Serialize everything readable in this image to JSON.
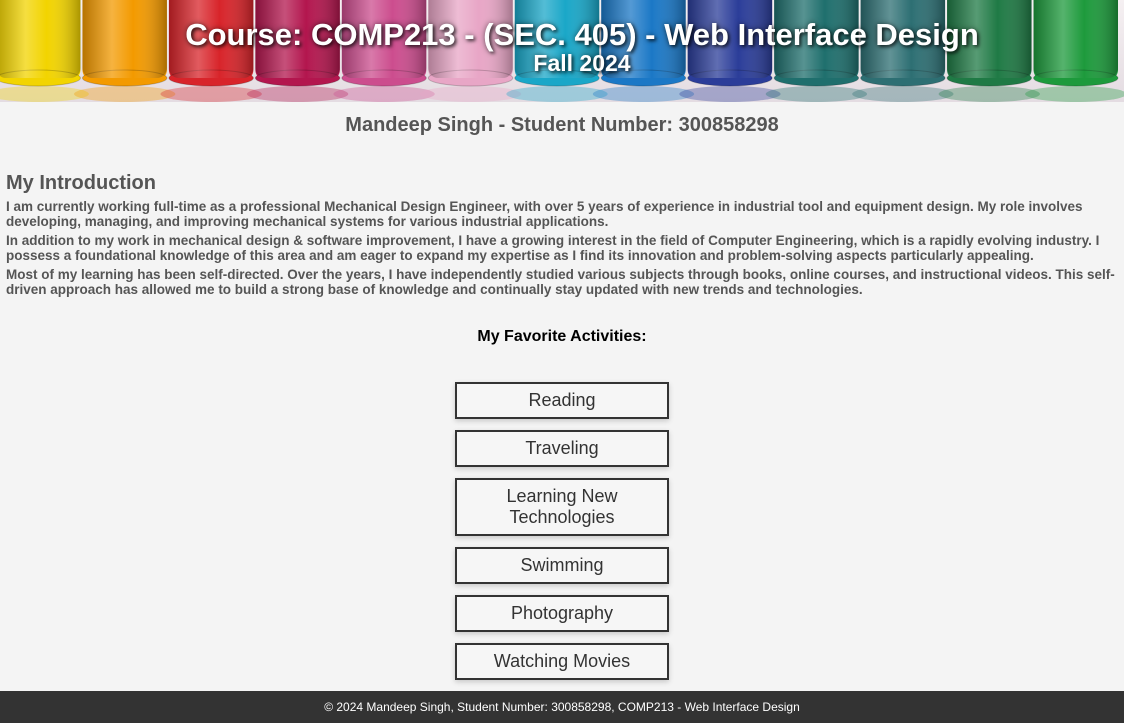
{
  "header": {
    "title": "Course: COMP213 - (SEC. 405) - Web Interface Design",
    "subtitle": "Fall 2024",
    "crayon_colors": [
      "#f2d400",
      "#f39a00",
      "#d8242a",
      "#b3164e",
      "#cc4d8e",
      "#e8a6c6",
      "#1aa7c8",
      "#1b78c6",
      "#2b3d99",
      "#1f6f6d",
      "#2d6f73",
      "#1f7a45",
      "#1d9a3c"
    ]
  },
  "student": {
    "line": "Mandeep Singh - Student Number: 300858298"
  },
  "intro": {
    "heading": "My Introduction",
    "paragraphs": [
      "I am currently working full-time as a professional Mechanical Design Engineer, with over 5 years of experience in industrial tool and equipment design. My role involves developing, managing, and improving mechanical systems for various industrial applications.",
      "In addition to my work in mechanical design & software improvement, I have a growing interest in the field of Computer Engineering, which is a rapidly evolving industry. I possess a foundational knowledge of this area and am eager to expand my expertise as I find its innovation and problem-solving aspects particularly appealing.",
      "Most of my learning has been self-directed. Over the years, I have independently studied various subjects through books, online courses, and instructional videos. This self-driven approach has allowed me to build a strong base of knowledge and continually stay updated with new trends and technologies."
    ]
  },
  "activities": {
    "heading": "My Favorite Activities:",
    "items": [
      "Reading",
      "Traveling",
      "Learning New Technologies",
      "Swimming",
      "Photography",
      "Watching Movies"
    ]
  },
  "footer": {
    "text": "© 2024 Mandeep Singh, Student Number: 300858298, COMP213 - Web Interface Design"
  }
}
